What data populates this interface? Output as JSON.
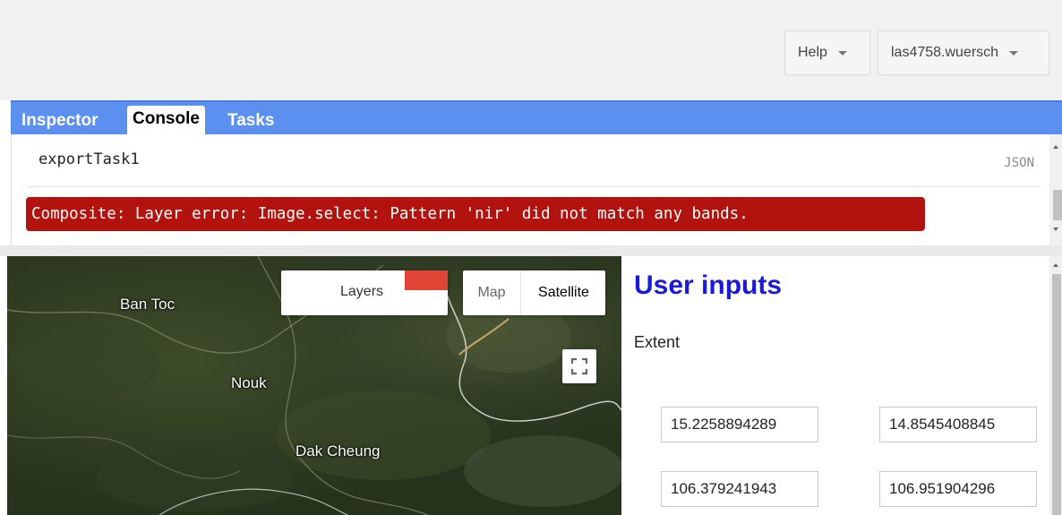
{
  "topbar": {
    "help_label": "Help",
    "user_label": "las4758.wuersch"
  },
  "tabs": [
    {
      "label": "Inspector",
      "active": false
    },
    {
      "label": "Console",
      "active": true
    },
    {
      "label": "Tasks",
      "active": false
    }
  ],
  "console": {
    "entry_name": "exportTask1",
    "entry_type": "JSON",
    "error_message": "Composite: Layer error: Image.select: Pattern 'nir' did not match any bands."
  },
  "map": {
    "places": [
      "Ban Toc",
      "Nouk",
      "Dak Cheung"
    ],
    "layers_label": "Layers",
    "layer_color": "#e04434",
    "maptype": {
      "map_label": "Map",
      "satellite_label": "Satellite",
      "selected": "Satellite"
    },
    "fullscreen_icon": "fullscreen-icon"
  },
  "panel": {
    "title": "User inputs",
    "extent_label": "Extent",
    "coords": [
      "15.2258894289",
      "14.8545408845",
      "106.379241943",
      "106.951904296"
    ]
  }
}
